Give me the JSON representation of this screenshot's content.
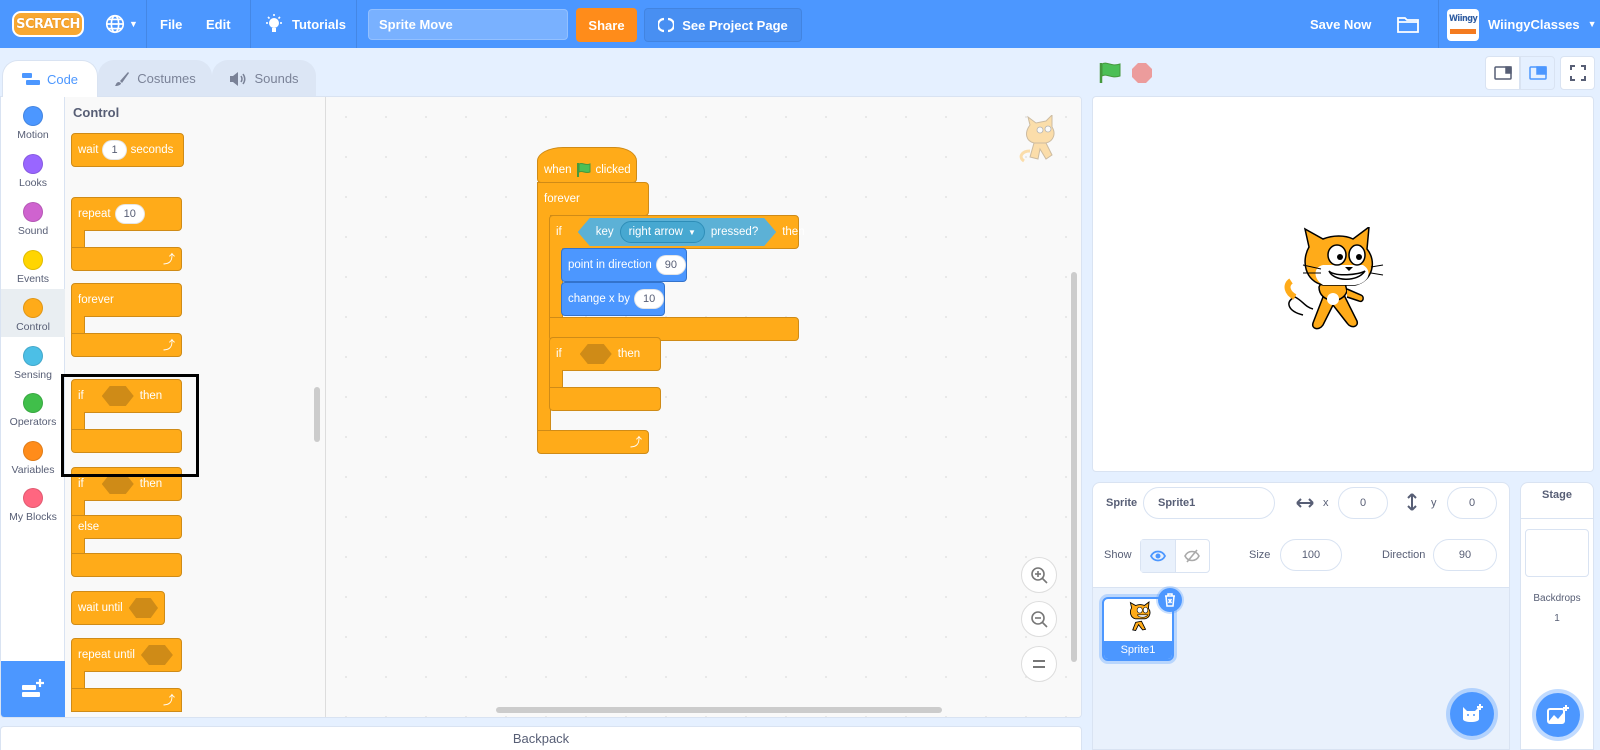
{
  "menubar": {
    "logo": "SCRATCH",
    "language_icon": "globe-icon",
    "file": "File",
    "edit": "Edit",
    "tutorials": "Tutorials",
    "project_title": "Sprite Move",
    "share": "Share",
    "see_project_page": "See Project Page",
    "save_now": "Save Now",
    "my_stuff_icon": "folder-icon",
    "avatar_text": "Wiingy",
    "username": "WiingyClasses"
  },
  "tabs": [
    {
      "label": "Code",
      "icon": "code-icon",
      "active": true
    },
    {
      "label": "Costumes",
      "icon": "brush-icon",
      "active": false
    },
    {
      "label": "Sounds",
      "icon": "speaker-icon",
      "active": false
    }
  ],
  "categories": [
    {
      "label": "Motion",
      "color": "#4c97ff"
    },
    {
      "label": "Looks",
      "color": "#9966ff"
    },
    {
      "label": "Sound",
      "color": "#cf63cf"
    },
    {
      "label": "Events",
      "color": "#ffd500"
    },
    {
      "label": "Control",
      "color": "#ffab19",
      "selected": true
    },
    {
      "label": "Sensing",
      "color": "#4cbfe6"
    },
    {
      "label": "Operators",
      "color": "#40bf4a"
    },
    {
      "label": "Variables",
      "color": "#ff8c1a"
    },
    {
      "label": "My Blocks",
      "color": "#ff6680"
    }
  ],
  "palette": {
    "title": "Control",
    "blocks": {
      "wait": {
        "label": "wait",
        "value": "1",
        "suffix": "seconds"
      },
      "repeat": {
        "label": "repeat",
        "value": "10"
      },
      "forever": {
        "label": "forever"
      },
      "if_then": {
        "label": "if",
        "suffix": "then"
      },
      "if_else": {
        "label": "if",
        "suffix": "then",
        "else": "else"
      },
      "wait_until": {
        "label": "wait until"
      },
      "repeat_until": {
        "label": "repeat until"
      }
    }
  },
  "script": {
    "hat": {
      "when": "when",
      "clicked": "clicked"
    },
    "forever": "forever",
    "if1": {
      "if": "if",
      "key": "key",
      "key_value": "right arrow",
      "pressed": "pressed?",
      "then": "then"
    },
    "point": {
      "label": "point in direction",
      "value": "90"
    },
    "change_x": {
      "label": "change x by",
      "value": "10"
    },
    "if2": {
      "if": "if",
      "then": "then"
    }
  },
  "zoom": {
    "in": "+",
    "out": "−",
    "reset": "="
  },
  "backpack": "Backpack",
  "sprite_info": {
    "sprite_label": "Sprite",
    "sprite_name": "Sprite1",
    "x_label": "x",
    "x_value": "0",
    "y_label": "y",
    "y_value": "0",
    "show_label": "Show",
    "size_label": "Size",
    "size_value": "100",
    "direction_label": "Direction",
    "direction_value": "90"
  },
  "sprites": [
    {
      "name": "Sprite1",
      "selected": true
    }
  ],
  "stage_pane": {
    "title": "Stage",
    "backdrops_label": "Backdrops",
    "backdrops_count": "1"
  }
}
